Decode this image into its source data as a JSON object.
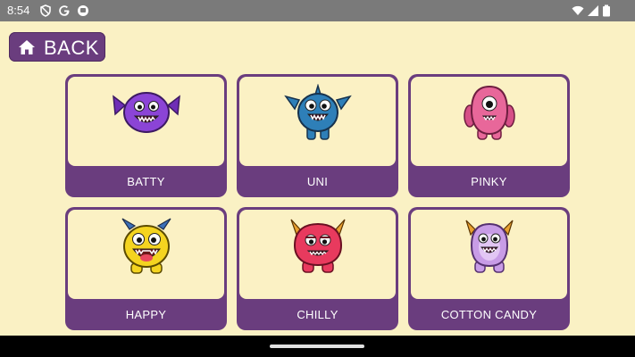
{
  "status_bar": {
    "time": "8:54",
    "left_icons": [
      "shield-icon",
      "google-icon",
      "app-notification-icon"
    ],
    "right_icons": [
      "wifi-icon",
      "cellular-signal-icon",
      "battery-icon"
    ]
  },
  "back_button": {
    "label": "BACK",
    "icon": "home-icon"
  },
  "monsters": [
    {
      "name": "BATTY",
      "color": "#8b44d6"
    },
    {
      "name": "UNI",
      "color": "#2e7fb8"
    },
    {
      "name": "PINKY",
      "color": "#e8679a"
    },
    {
      "name": "HAPPY",
      "color": "#f4d420"
    },
    {
      "name": "CHILLY",
      "color": "#e83a5e"
    },
    {
      "name": "COTTON CANDY",
      "color": "#c89ce6"
    }
  ],
  "colors": {
    "background": "#faf1c4",
    "card": "#6a3d7e",
    "card_face": "#fbf1c4",
    "status_bar": "#7a7a7a"
  }
}
